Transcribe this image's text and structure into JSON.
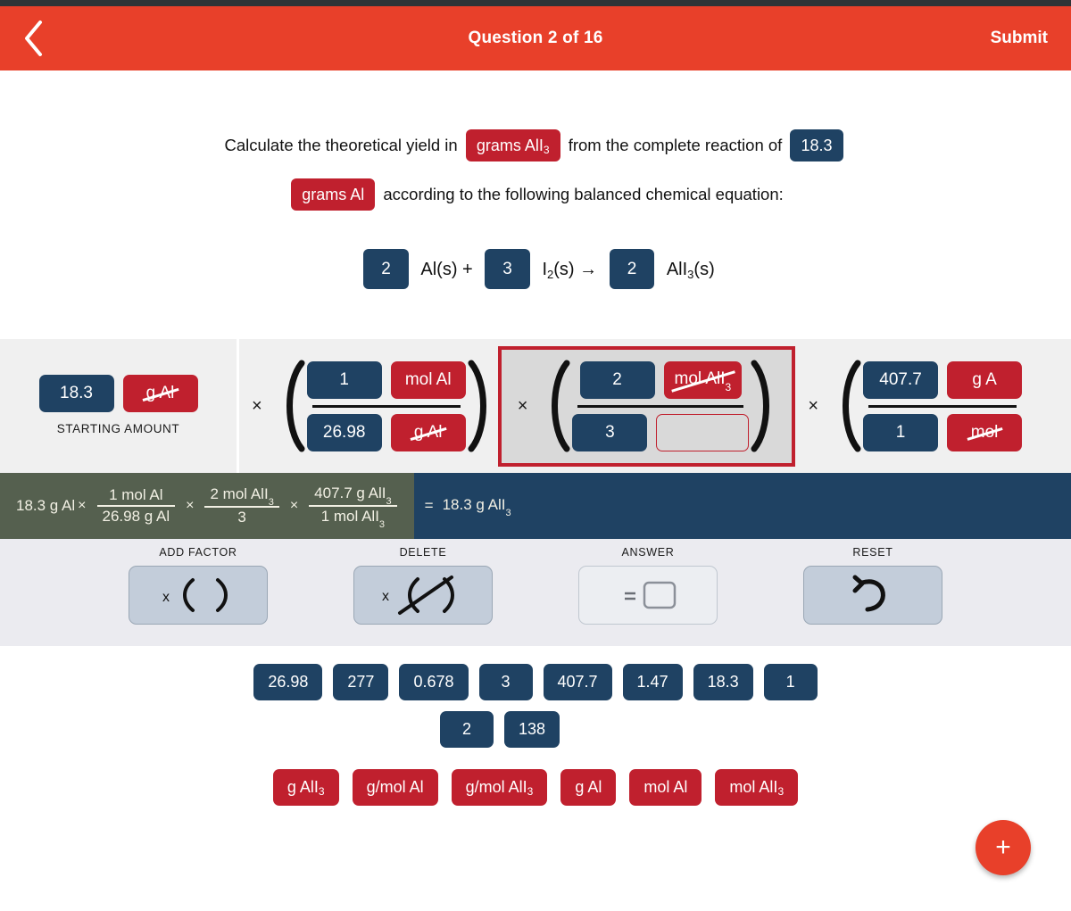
{
  "header": {
    "back_icon": "chevron-left-icon",
    "title": "Question 2 of 16",
    "submit_label": "Submit",
    "bg_color": "#e8402a"
  },
  "prompt": {
    "part1": "Calculate the theoretical yield in",
    "chip_units": "grams AlI",
    "chip_units_sub": "3",
    "part2": "from the complete reaction of",
    "chip_amount": "18.3",
    "chip_mass_units": "grams Al",
    "part3": "according to the following balanced chemical equation:"
  },
  "equation": {
    "coeff1": "2",
    "species1": "Al(s) +",
    "coeff2": "3",
    "species2_main": "I",
    "species2_sub": "2",
    "species2_tail": "(s) →",
    "coeff3": "2",
    "species3_main": "AlI",
    "species3_sub": "3",
    "species3_tail": "(s)"
  },
  "work": {
    "starting_amount_value": "18.3",
    "starting_amount_unit": "g Al",
    "starting_amount_label": "STARTING AMOUNT",
    "multiply_symbol": "×",
    "factors": [
      {
        "num_value": "1",
        "num_unit": "mol Al",
        "num_unit_cancelled": false,
        "den_value": "26.98",
        "den_unit": "g Al",
        "den_unit_cancelled": true,
        "selected": false
      },
      {
        "num_value": "2",
        "num_unit": "mol AlI",
        "num_unit_sub": "3",
        "num_unit_cancelled": true,
        "den_value": "3",
        "den_unit": "",
        "den_unit_empty": true,
        "selected": true
      },
      {
        "num_value": "407.7",
        "num_unit": "g A",
        "num_unit_cancelled": false,
        "den_value": "1",
        "den_unit": "mol",
        "den_unit_cancelled": true,
        "selected": false
      }
    ]
  },
  "summary": {
    "start": "18.3 g Al",
    "mul": "×",
    "terms": [
      {
        "num": "1 mol Al",
        "den": "26.98 g Al"
      },
      {
        "num": "2 mol AlI",
        "num_sub": "3",
        "den": "3",
        "den_sub": ""
      },
      {
        "num": "407.7 g AlI",
        "num_sub": "3",
        "den": "1 mol AlI",
        "den_sub": "3"
      }
    ],
    "equals": "=",
    "result": "18.3 g AlI",
    "result_sub": "3"
  },
  "toolbar": [
    {
      "label": "ADD FACTOR",
      "icon": "add-factor-icon",
      "disabled": false
    },
    {
      "label": "DELETE",
      "icon": "delete-factor-icon",
      "disabled": false
    },
    {
      "label": "ANSWER",
      "icon": "answer-box-icon",
      "disabled": true
    },
    {
      "label": "RESET",
      "icon": "reset-arrow-icon",
      "disabled": false
    }
  ],
  "palette": {
    "numbers_row1": [
      "26.98",
      "277",
      "0.678",
      "3",
      "407.7",
      "1.47",
      "18.3",
      "1"
    ],
    "numbers_row2": [
      "2",
      "138"
    ],
    "units": [
      {
        "text": "g AlI",
        "sub": "3"
      },
      {
        "text": "g/mol Al",
        "sub": ""
      },
      {
        "text": "g/mol AlI",
        "sub": "3"
      },
      {
        "text": "g Al",
        "sub": ""
      },
      {
        "text": "mol Al",
        "sub": ""
      },
      {
        "text": "mol AlI",
        "sub": "3"
      }
    ]
  },
  "fab": {
    "icon": "plus-icon",
    "label": "+",
    "color": "#e8402a"
  },
  "colors": {
    "navy": "#1f4263",
    "red": "#c0202e",
    "header": "#e8402a",
    "work_bg": "#f0f0f0",
    "summary_bg": "#1f4263"
  }
}
